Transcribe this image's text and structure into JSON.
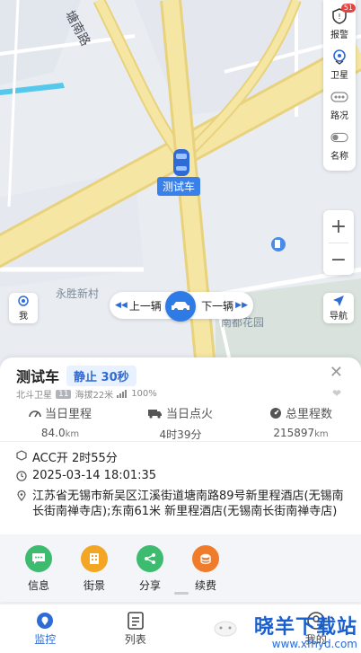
{
  "map": {
    "road_label": "塘南路",
    "place_labels": [
      "永胜新村",
      "南都花园"
    ],
    "car_tag": "测试车"
  },
  "controls": [
    {
      "label": "报警",
      "icon": "alarm-shield-icon",
      "badge": "51"
    },
    {
      "label": "卫星",
      "icon": "satellite-icon"
    },
    {
      "label": "路况",
      "icon": "traffic-icon"
    },
    {
      "label": "名称",
      "icon": "name-toggle-icon"
    }
  ],
  "zoom": {
    "in": "+",
    "out": "−"
  },
  "me_button": "我",
  "nav_button": "导航",
  "switcher": {
    "prev": "上一辆",
    "next": "下一辆"
  },
  "vehicle": {
    "name": "测试车",
    "status": "静止 30秒",
    "positioning": "北斗卫星",
    "sat_count": "11",
    "altitude": "海拔22米",
    "signal": "100%"
  },
  "stats": [
    {
      "label": "当日里程",
      "value": "84.0",
      "unit": "km",
      "icon": "speedometer-icon"
    },
    {
      "label": "当日点火",
      "value": "4时39分",
      "unit": "",
      "icon": "truck-icon"
    },
    {
      "label": "总里程数",
      "value": "215897",
      "unit": "km",
      "icon": "gauge-icon"
    }
  ],
  "info": {
    "acc": "ACC开 2时55分",
    "time": "2025-03-14 18:01:35",
    "address": "江苏省无锡市新吴区江溪街道塘南路89号新里程酒店(无锡南长街南禅寺店);东南61米 新里程酒店(无锡南长街南禅寺店)"
  },
  "actions": [
    {
      "label": "信息",
      "color": "#3dbb6f",
      "icon": "chat-icon"
    },
    {
      "label": "街景",
      "color": "#f3a623",
      "icon": "building-icon"
    },
    {
      "label": "分享",
      "color": "#3dbb6f",
      "icon": "share-icon"
    },
    {
      "label": "续费",
      "color": "#f07b2a",
      "icon": "coins-icon"
    }
  ],
  "bottom_nav": [
    {
      "label": "监控",
      "active": true,
      "icon": "location-pin-icon"
    },
    {
      "label": "列表",
      "active": false,
      "icon": "list-icon"
    },
    {
      "label": "",
      "active": false,
      "icon": "mascot-icon"
    },
    {
      "label": "我的",
      "active": false,
      "icon": "profile-icon"
    }
  ],
  "watermark": {
    "title": "晓羊下载站",
    "url": "www.xfhyd.com"
  },
  "colors": {
    "accent": "#2f6bd6",
    "road": "#f6e6a3",
    "map_bg": "#e9edf2"
  }
}
